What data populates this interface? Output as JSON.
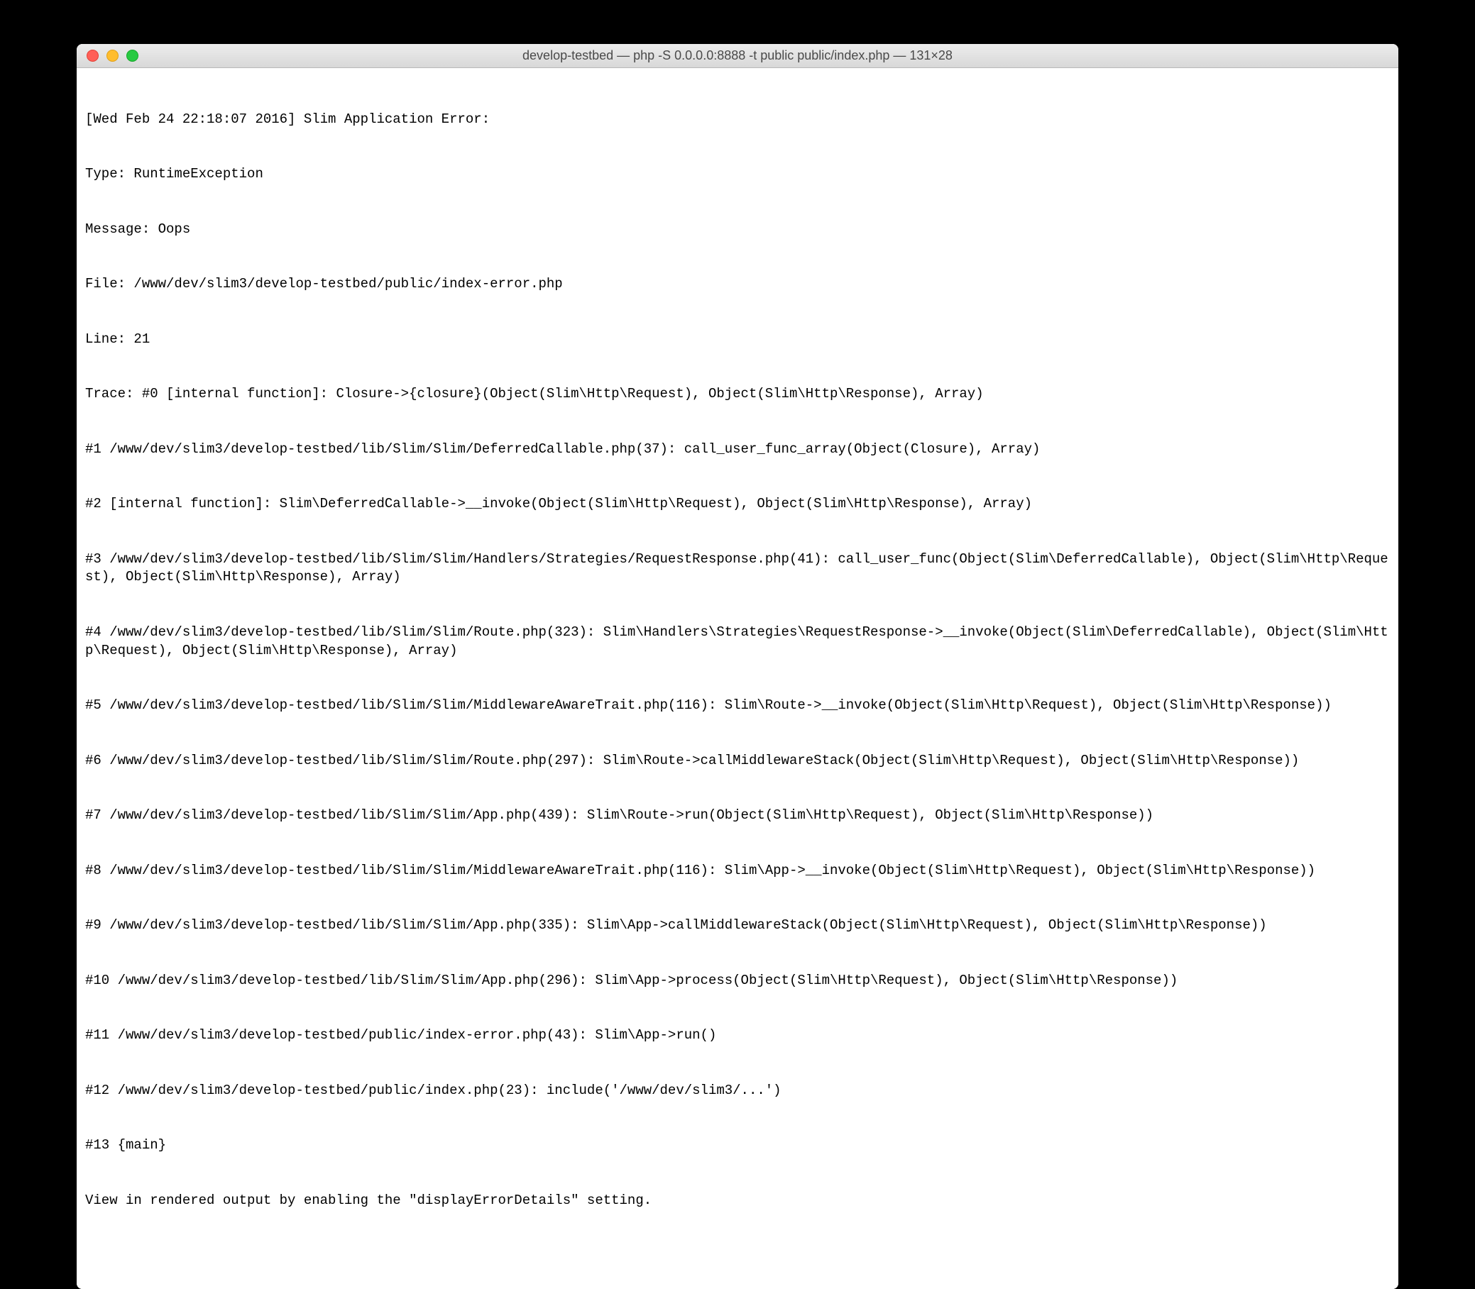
{
  "window": {
    "title": "develop-testbed — php -S 0.0.0.0:8888 -t public public/index.php — 131×28"
  },
  "terminal": {
    "lines": [
      "[Wed Feb 24 22:18:07 2016] Slim Application Error:",
      "Type: RuntimeException",
      "Message: Oops",
      "File: /www/dev/slim3/develop-testbed/public/index-error.php",
      "Line: 21",
      "Trace: #0 [internal function]: Closure->{closure}(Object(Slim\\Http\\Request), Object(Slim\\Http\\Response), Array)",
      "#1 /www/dev/slim3/develop-testbed/lib/Slim/Slim/DeferredCallable.php(37): call_user_func_array(Object(Closure), Array)",
      "#2 [internal function]: Slim\\DeferredCallable->__invoke(Object(Slim\\Http\\Request), Object(Slim\\Http\\Response), Array)",
      "#3 /www/dev/slim3/develop-testbed/lib/Slim/Slim/Handlers/Strategies/RequestResponse.php(41): call_user_func(Object(Slim\\DeferredCallable), Object(Slim\\Http\\Request), Object(Slim\\Http\\Response), Array)",
      "#4 /www/dev/slim3/develop-testbed/lib/Slim/Slim/Route.php(323): Slim\\Handlers\\Strategies\\RequestResponse->__invoke(Object(Slim\\DeferredCallable), Object(Slim\\Http\\Request), Object(Slim\\Http\\Response), Array)",
      "#5 /www/dev/slim3/develop-testbed/lib/Slim/Slim/MiddlewareAwareTrait.php(116): Slim\\Route->__invoke(Object(Slim\\Http\\Request), Object(Slim\\Http\\Response))",
      "#6 /www/dev/slim3/develop-testbed/lib/Slim/Slim/Route.php(297): Slim\\Route->callMiddlewareStack(Object(Slim\\Http\\Request), Object(Slim\\Http\\Response))",
      "#7 /www/dev/slim3/develop-testbed/lib/Slim/Slim/App.php(439): Slim\\Route->run(Object(Slim\\Http\\Request), Object(Slim\\Http\\Response))",
      "#8 /www/dev/slim3/develop-testbed/lib/Slim/Slim/MiddlewareAwareTrait.php(116): Slim\\App->__invoke(Object(Slim\\Http\\Request), Object(Slim\\Http\\Response))",
      "#9 /www/dev/slim3/develop-testbed/lib/Slim/Slim/App.php(335): Slim\\App->callMiddlewareStack(Object(Slim\\Http\\Request), Object(Slim\\Http\\Response))",
      "#10 /www/dev/slim3/develop-testbed/lib/Slim/Slim/App.php(296): Slim\\App->process(Object(Slim\\Http\\Request), Object(Slim\\Http\\Response))",
      "#11 /www/dev/slim3/develop-testbed/public/index-error.php(43): Slim\\App->run()",
      "#12 /www/dev/slim3/develop-testbed/public/index.php(23): include('/www/dev/slim3/...')",
      "#13 {main}",
      "View in rendered output by enabling the \"displayErrorDetails\" setting."
    ]
  }
}
